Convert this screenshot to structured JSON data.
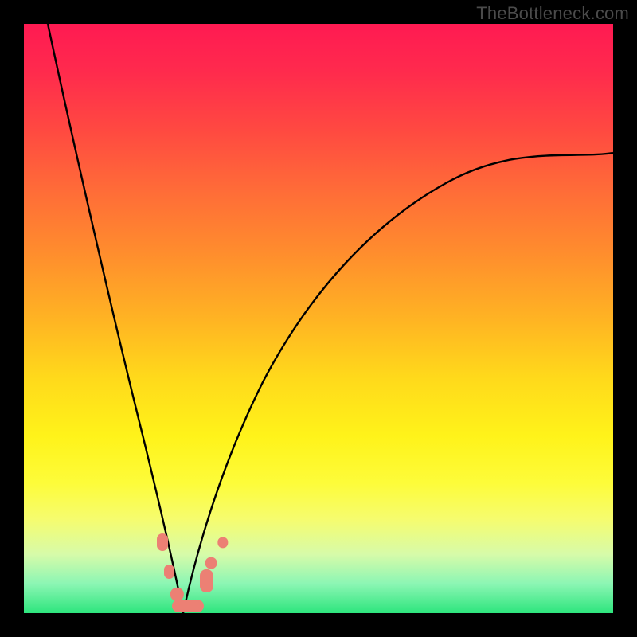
{
  "watermark": "TheBottleneck.com",
  "colors": {
    "curve": "#000000",
    "marker": "#ec8074",
    "frame_bg_top": "#ff1a52",
    "frame_bg_bottom": "#2de57d",
    "page_bg": "#000000"
  },
  "chart_data": {
    "type": "line",
    "title": "",
    "xlabel": "",
    "ylabel": "",
    "xlim": [
      0,
      100
    ],
    "ylim": [
      0,
      100
    ],
    "grid": false,
    "description": "Bottleneck percentage curve; two monotone branches meeting at a minimum near x≈27, y≈0. Left arm is steep (from ~(4,100) down to vertex), right arm rises with decreasing slope toward ~(100,78).",
    "series": [
      {
        "name": "left-arm",
        "x": [
          4,
          6,
          8,
          10,
          12,
          14,
          16,
          18,
          20,
          22,
          24,
          26,
          27
        ],
        "y": [
          100,
          90,
          80,
          70,
          60,
          50,
          41,
          32,
          24,
          16,
          9,
          3,
          0
        ]
      },
      {
        "name": "right-arm",
        "x": [
          27,
          29,
          31,
          34,
          38,
          42,
          47,
          53,
          60,
          68,
          77,
          88,
          100
        ],
        "y": [
          0,
          3,
          7,
          12,
          19,
          26,
          33,
          41,
          49,
          57,
          64,
          71,
          78
        ]
      }
    ],
    "markers": [
      {
        "x": 23.5,
        "y": 12,
        "shape": "blob",
        "w_pct": 2.0,
        "h_pct": 3.0
      },
      {
        "x": 24.7,
        "y": 7,
        "shape": "blob",
        "w_pct": 1.8,
        "h_pct": 2.5
      },
      {
        "x": 26.0,
        "y": 3.2,
        "shape": "dot",
        "r_pct": 1.1
      },
      {
        "x": 27.0,
        "y": 1.2,
        "shape": "blob",
        "w_pct": 3.8,
        "h_pct": 2.2
      },
      {
        "x": 29.0,
        "y": 1.2,
        "shape": "blob",
        "w_pct": 3.0,
        "h_pct": 2.2
      },
      {
        "x": 31.0,
        "y": 5.5,
        "shape": "blob",
        "w_pct": 2.2,
        "h_pct": 4.0
      },
      {
        "x": 31.8,
        "y": 8.5,
        "shape": "dot",
        "r_pct": 1.0
      },
      {
        "x": 33.8,
        "y": 12,
        "shape": "dot",
        "r_pct": 0.9
      }
    ]
  }
}
